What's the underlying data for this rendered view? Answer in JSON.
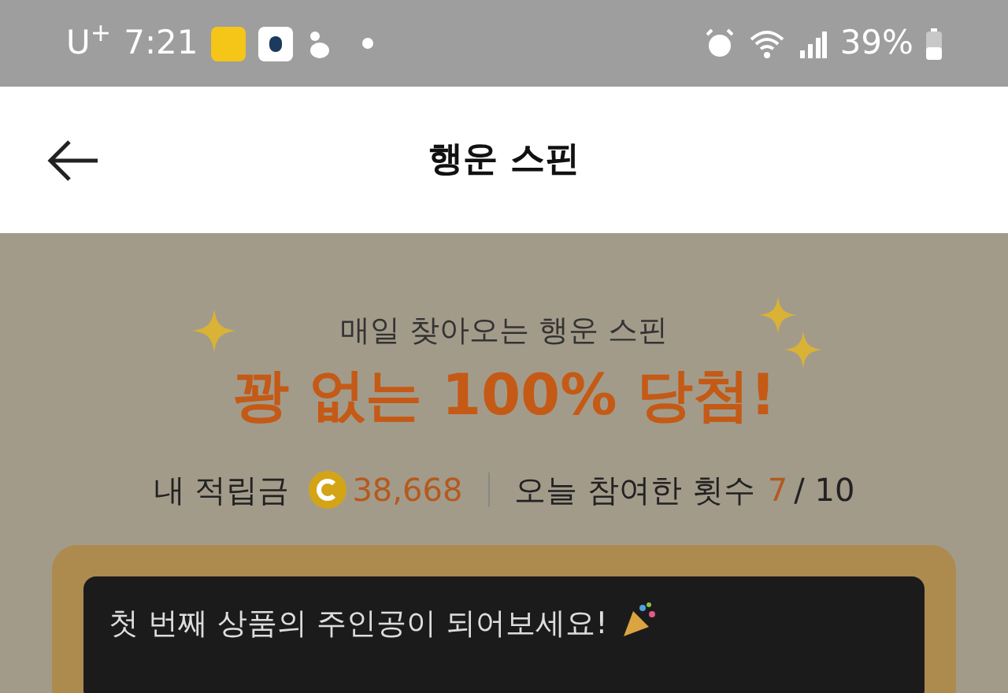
{
  "status_bar": {
    "carrier": "U$^{+}$",
    "time": "7:21",
    "battery": "39%"
  },
  "header": {
    "title": "행운 스핀"
  },
  "hero": {
    "subtitle": "매일 찾아오는 행운 스핀",
    "headline": "꽝 없는 100% 당첨!"
  },
  "stats": {
    "points_label": "내 적립금",
    "points": "38,668",
    "count_label": "오늘 참여한 횟수",
    "count_done": "7",
    "count_total": "/ 10"
  },
  "banner": {
    "text": "첫 번째 상품의 주인공이 되어보세요!"
  }
}
